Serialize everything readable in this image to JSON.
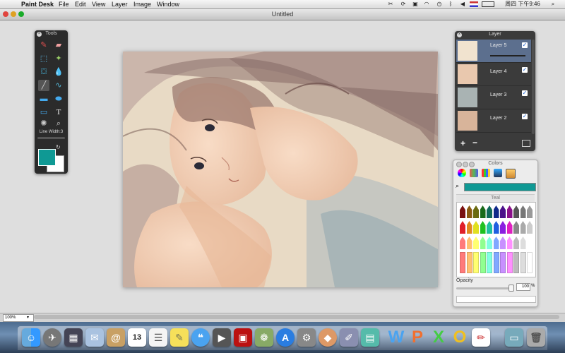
{
  "menubar": {
    "app_name": "Paint Desk",
    "menus": [
      "File",
      "Edit",
      "View",
      "Layer",
      "Image",
      "Window"
    ],
    "clock": "周四 下午9:46"
  },
  "window": {
    "title": "Untitled"
  },
  "tools_panel": {
    "title": "Tools",
    "line_width_label": "Line Width:3",
    "foreground_color": "#0f9994",
    "background_color": "#ffffff"
  },
  "layer_panel": {
    "title": "Layer",
    "layers": [
      {
        "name": "Layer 5",
        "visible": true
      },
      {
        "name": "Layer 4",
        "visible": true
      },
      {
        "name": "Layer 3",
        "visible": true
      },
      {
        "name": "Layer 2",
        "visible": true
      }
    ],
    "add_label": "+",
    "remove_label": "−"
  },
  "colors_panel": {
    "title": "Colors",
    "selected_name": "Teal",
    "selected_color": "#0f9994",
    "opacity_label": "Opacity",
    "opacity_value": "100",
    "opacity_unit": "%"
  },
  "statusbar": {
    "zoom": "100%"
  }
}
